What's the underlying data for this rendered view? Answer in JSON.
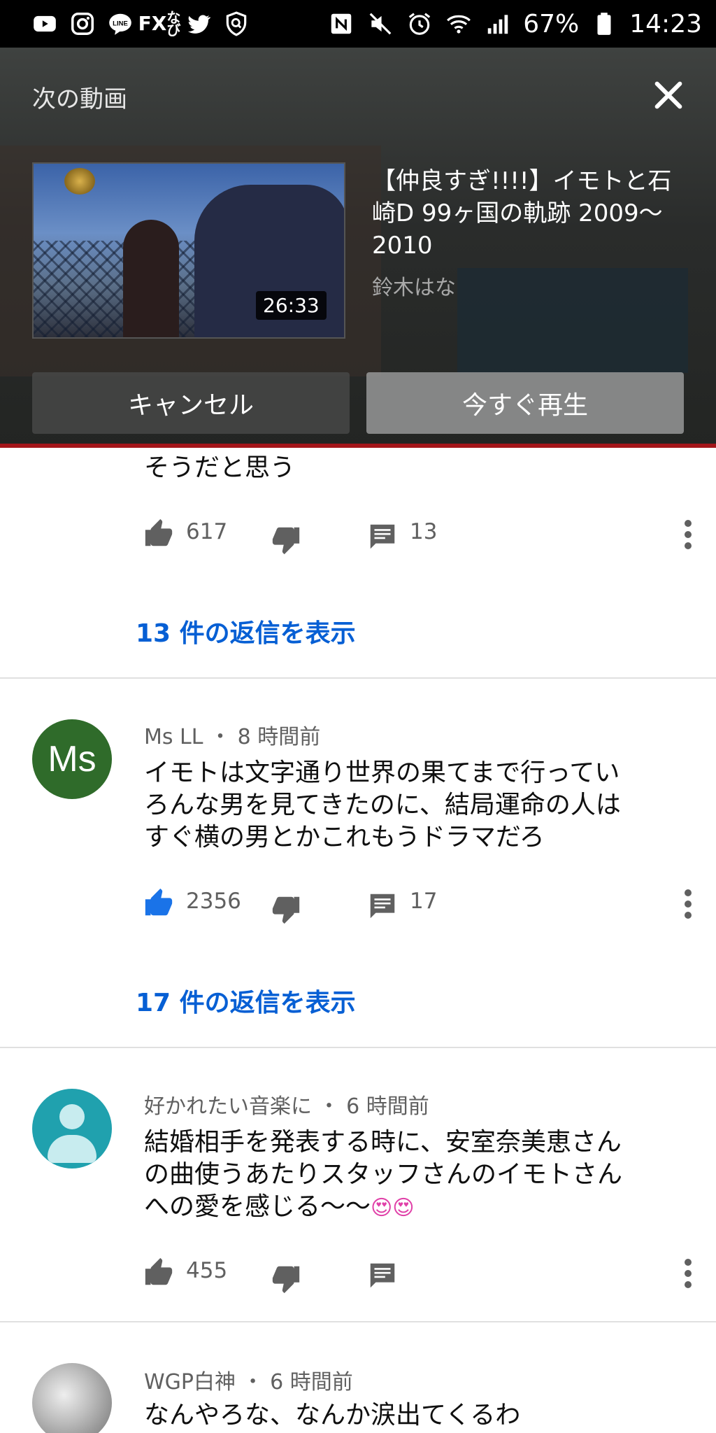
{
  "status_bar": {
    "fx_label_top": "FX",
    "fx_label_bottom": "なび",
    "battery": "67%",
    "time": "14:23",
    "left_icons": [
      "youtube-icon",
      "instagram-icon",
      "line-icon",
      "fx-nabi-icon",
      "twitter-icon",
      "shield-app-icon"
    ],
    "right_icons": [
      "nfc-icon",
      "mute-icon",
      "alarm-icon",
      "wifi-icon",
      "signal-icon",
      "battery-icon"
    ]
  },
  "up_next": {
    "header": "次の動画",
    "video_title": "【仲良すぎ!!!!】イモトと石崎D 99ヶ国の軌跡 2009〜2010",
    "channel": "鈴木はな",
    "duration": "26:33",
    "cancel_label": "キャンセル",
    "play_now_label": "今すぐ再生",
    "accent_color": "#a4161a"
  },
  "comments": [
    {
      "text": "そうだと思う",
      "likes": "617",
      "replies": "13",
      "liked": false,
      "show_replies": "13 件の返信を表示"
    },
    {
      "avatar_text": "Ms",
      "author": "Ms LL",
      "time": "8 時間前",
      "text_lines": [
        "イモトは文字通り世界の果てまで行ってい",
        "ろんな男を見てきたのに、結局運命の人は",
        "すぐ横の男とかこれもうドラマだろ"
      ],
      "likes": "2356",
      "replies": "17",
      "liked": true,
      "show_replies": "17 件の返信を表示"
    },
    {
      "author": "好かれたい音楽に",
      "time": "6 時間前",
      "text_lines": [
        "結婚相手を発表する時に、安室奈美恵さん",
        "の曲使うあたりスタッフさんのイモトさん",
        "への愛を感じる〜〜"
      ],
      "emoji": "😍😍",
      "likes": "455",
      "liked": false
    },
    {
      "author": "WGP白神",
      "time": "6 時間前",
      "text": "なんやろな、なんか涙出てくるわ"
    }
  ],
  "colors": {
    "link_blue": "#065fd4",
    "like_active": "#1a73e8",
    "icon_gray": "#606060"
  }
}
